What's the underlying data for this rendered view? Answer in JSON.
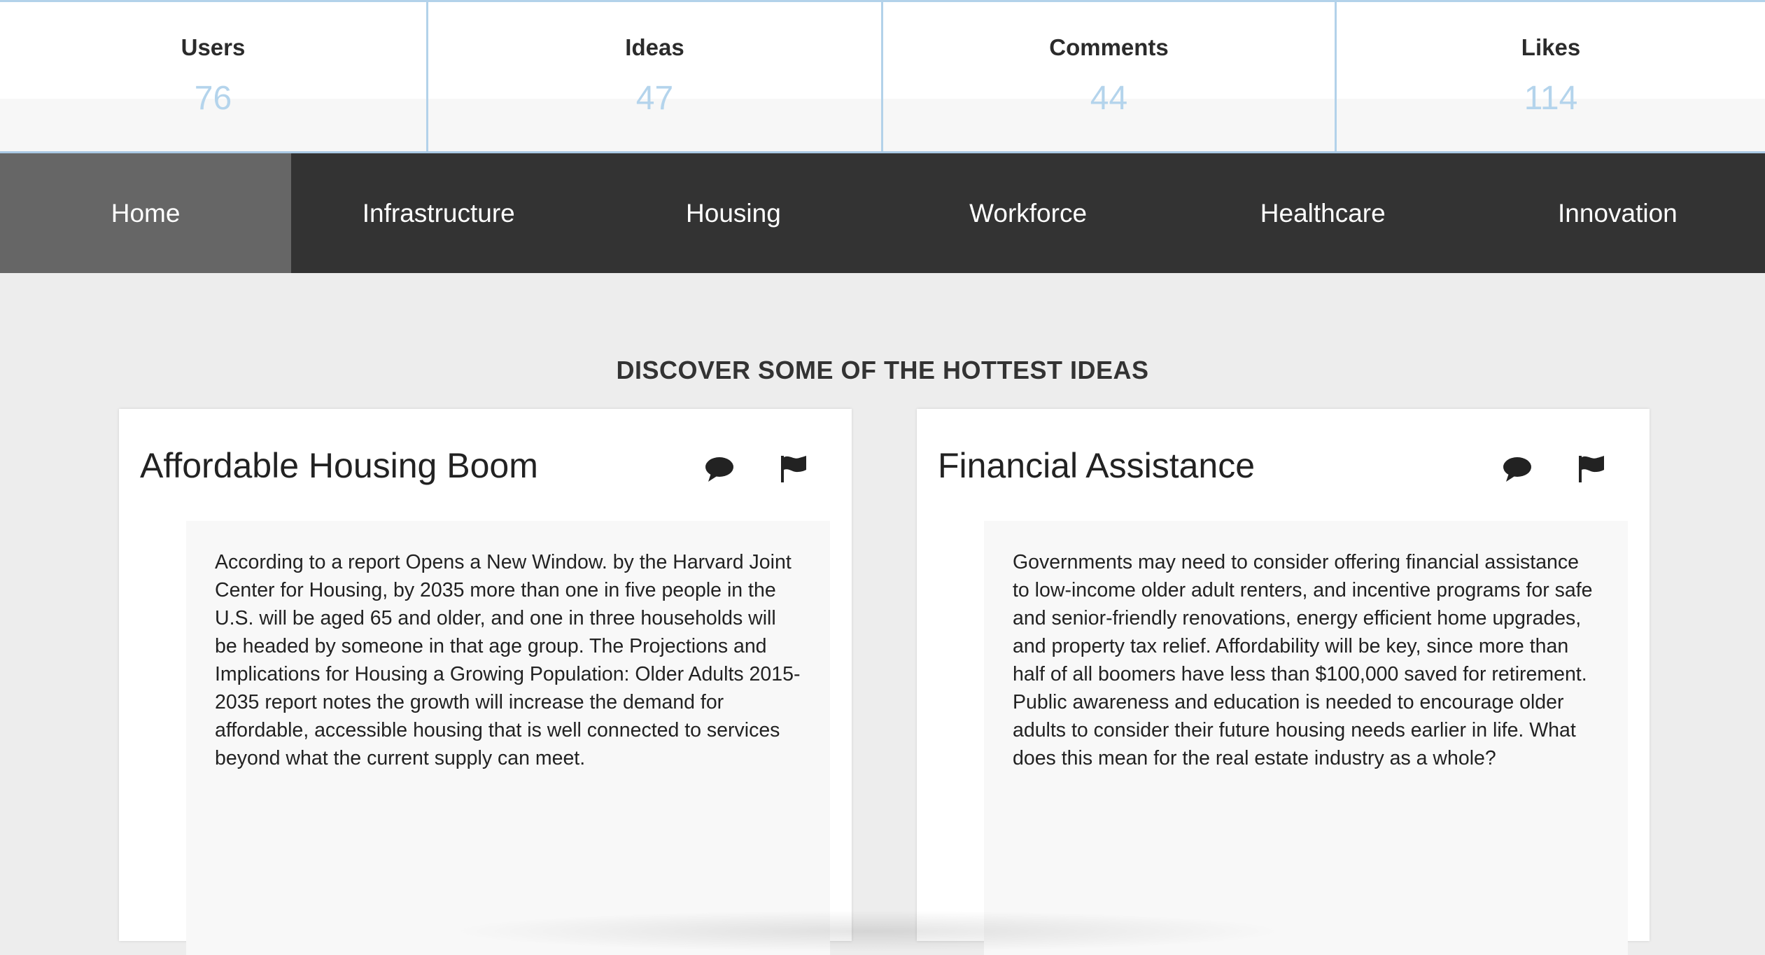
{
  "stats": [
    {
      "label": "Users",
      "value": "76"
    },
    {
      "label": "Ideas",
      "value": "47"
    },
    {
      "label": "Comments",
      "value": "44"
    },
    {
      "label": "Likes",
      "value": "114"
    }
  ],
  "nav": {
    "items": [
      {
        "label": "Home",
        "active": true
      },
      {
        "label": "Infrastructure"
      },
      {
        "label": "Housing"
      },
      {
        "label": "Workforce"
      },
      {
        "label": "Healthcare"
      },
      {
        "label": "Innovation"
      }
    ]
  },
  "section": {
    "title": "DISCOVER SOME OF THE HOTTEST IDEAS"
  },
  "cards": [
    {
      "title": "Affordable Housing Boom",
      "body": "According to a report Opens a New Window. by the Harvard Joint Center for Housing, by 2035 more than one in five people in the U.S. will be aged 65 and older, and one in three households will be headed by someone in that age group. The Projections and Implications for Housing a Growing Population: Older Adults 2015-2035 report notes the growth will increase the demand for affordable, accessible housing that is well connected to services beyond what the current supply can meet.",
      "icons": [
        "comment-icon",
        "flag-icon"
      ]
    },
    {
      "title": "Financial Assistance",
      "body": "Governments may need to consider offering financial assistance to low-income older adult renters, and incentive programs for safe and senior-friendly renovations, energy efficient home upgrades, and property tax relief. Affordability will be key, since more than half of all boomers have less than $100,000 saved for retirement. Public awareness and education is needed to encourage older adults to consider their future housing needs earlier in life. What does this mean for the real estate industry as a whole?",
      "icons": [
        "comment-icon",
        "flag-icon"
      ]
    }
  ],
  "colors": {
    "stat_border": "#b3d2ea",
    "stat_value": "#b4d4ec",
    "nav_bg": "#333333",
    "nav_active": "#666666",
    "page_bg": "#ededed"
  }
}
